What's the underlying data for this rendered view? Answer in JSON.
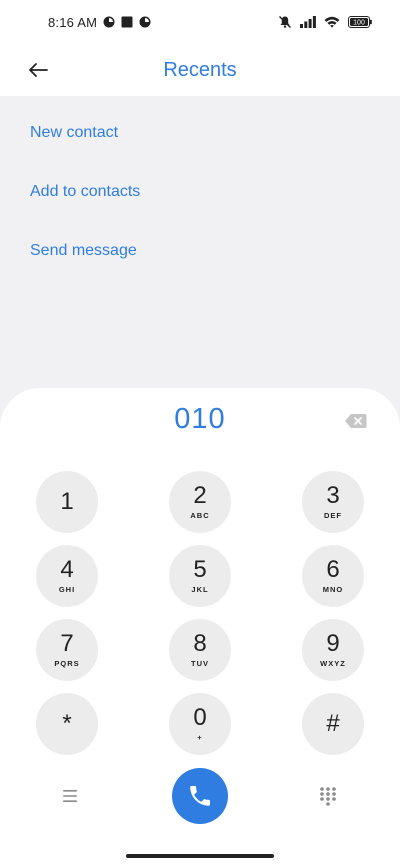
{
  "status_bar": {
    "time": "8:16 AM",
    "battery": "100",
    "icons": [
      "media-icon",
      "square-notification-icon",
      "timer-icon",
      "mute-icon",
      "signal-icon",
      "wifi-icon",
      "battery-icon"
    ]
  },
  "header": {
    "title": "Recents",
    "back_icon": "arrow-left-icon"
  },
  "actions": [
    {
      "label": "New contact"
    },
    {
      "label": "Add to contacts"
    },
    {
      "label": "Send message"
    }
  ],
  "dialer": {
    "number": "010",
    "keys": [
      {
        "digit": "1",
        "letters": ""
      },
      {
        "digit": "2",
        "letters": "ABC"
      },
      {
        "digit": "3",
        "letters": "DEF"
      },
      {
        "digit": "4",
        "letters": "GHI"
      },
      {
        "digit": "5",
        "letters": "JKL"
      },
      {
        "digit": "6",
        "letters": "MNO"
      },
      {
        "digit": "7",
        "letters": "PQRS"
      },
      {
        "digit": "8",
        "letters": "TUV"
      },
      {
        "digit": "9",
        "letters": "WXYZ"
      },
      {
        "digit": "*",
        "letters": ""
      },
      {
        "digit": "0",
        "letters": "+"
      },
      {
        "digit": "#",
        "letters": ""
      }
    ]
  },
  "colors": {
    "accent": "#2f7de1",
    "background": "#f1f1f3",
    "key_background": "#ececec"
  }
}
